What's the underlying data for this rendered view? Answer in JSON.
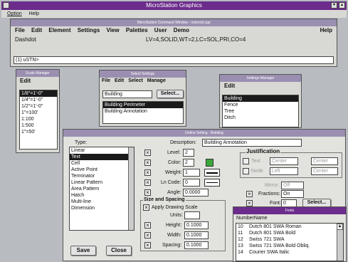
{
  "app_title": "MicroStation Graphics",
  "app_menu": [
    "Option",
    "Help"
  ],
  "main": {
    "title": "MicroStation Command Window - mstcmd.cpp",
    "menu": [
      "File",
      "Edit",
      "Element",
      "Settings",
      "View",
      "Palettes",
      "User",
      "Demo"
    ],
    "help": "Help",
    "style_name": "Dashdot",
    "status": "LV=4,SOLID,WT=2,LC=SOL,PRI,CO=4",
    "prompt": "(1) uSTN>"
  },
  "scale_win": {
    "title": "Scale Manager",
    "menu": "Edit",
    "items": [
      "1/8\"=1'-0\"",
      "1/4\"=1'-0\"",
      "1/2\"=1'-0\"",
      "1\"=100'",
      "1:100",
      "1:500",
      "1\"=50'"
    ]
  },
  "select_win": {
    "title": "Select Settings",
    "menu": [
      "File",
      "Edit",
      "Select",
      "Manage"
    ],
    "field": "Building",
    "button": "Select...",
    "items": [
      "Building Perimeter",
      "Building Annotation"
    ]
  },
  "settings_win": {
    "title": "Settings Manager",
    "menu": "Edit",
    "items": [
      "Building",
      "Fence",
      "Tree",
      "Ditch"
    ]
  },
  "define": {
    "title": "Define Setting - Building",
    "type_label": "Type:",
    "types": [
      "Linear",
      "Text",
      "Cell",
      "Active Point",
      "Terminator",
      "Linear Pattern",
      "Area Pattern",
      "Hatch",
      "Multi-line",
      "Dimension"
    ],
    "description_label": "Description:",
    "description": "Building Annotation",
    "level_label": "Level:",
    "level": "2",
    "color_label": "Color:",
    "color": "2",
    "weight_label": "Weight:",
    "weight": "1",
    "lncode_label": "Ln Code:",
    "lncode": "0",
    "angle_label": "Angle:",
    "angle": "0.0000",
    "size_group": "Size and Spacing",
    "apply_scale": "Apply Drawing Scale",
    "units_label": "Units:",
    "height_label": "Height:",
    "height": "0.1000",
    "width_label": "Width:",
    "width": "0.1000",
    "spacing_label": "Spacing:",
    "spacing": "0.1000",
    "just_group": "Justification",
    "text_label": "Text",
    "text_just": "Center",
    "text_just2": "Center",
    "node_label": "Node",
    "node_just": "Left",
    "node_just2": "Center",
    "mirror_label": "Mirror:",
    "mirror": "Off",
    "fractions_label": "Fractions:",
    "fractions": "On",
    "font_label": "Font:",
    "font": "0",
    "font_button": "Select...",
    "save": "Save",
    "close": "Close",
    "accent": "#3aa83a"
  },
  "fonts_win": {
    "title": "Fonts",
    "col_number": "Number",
    "col_name": "Name",
    "rows": [
      {
        "n": "10",
        "name": "Dutch 801 SWA Roman"
      },
      {
        "n": "11",
        "name": "Dutch 801 SWA Bold"
      },
      {
        "n": "12",
        "name": "Swiss 721 SWA"
      },
      {
        "n": "13",
        "name": "Swiss 721 SWA Bold Obliq."
      },
      {
        "n": "14",
        "name": "Courier SWA Italic"
      }
    ]
  }
}
